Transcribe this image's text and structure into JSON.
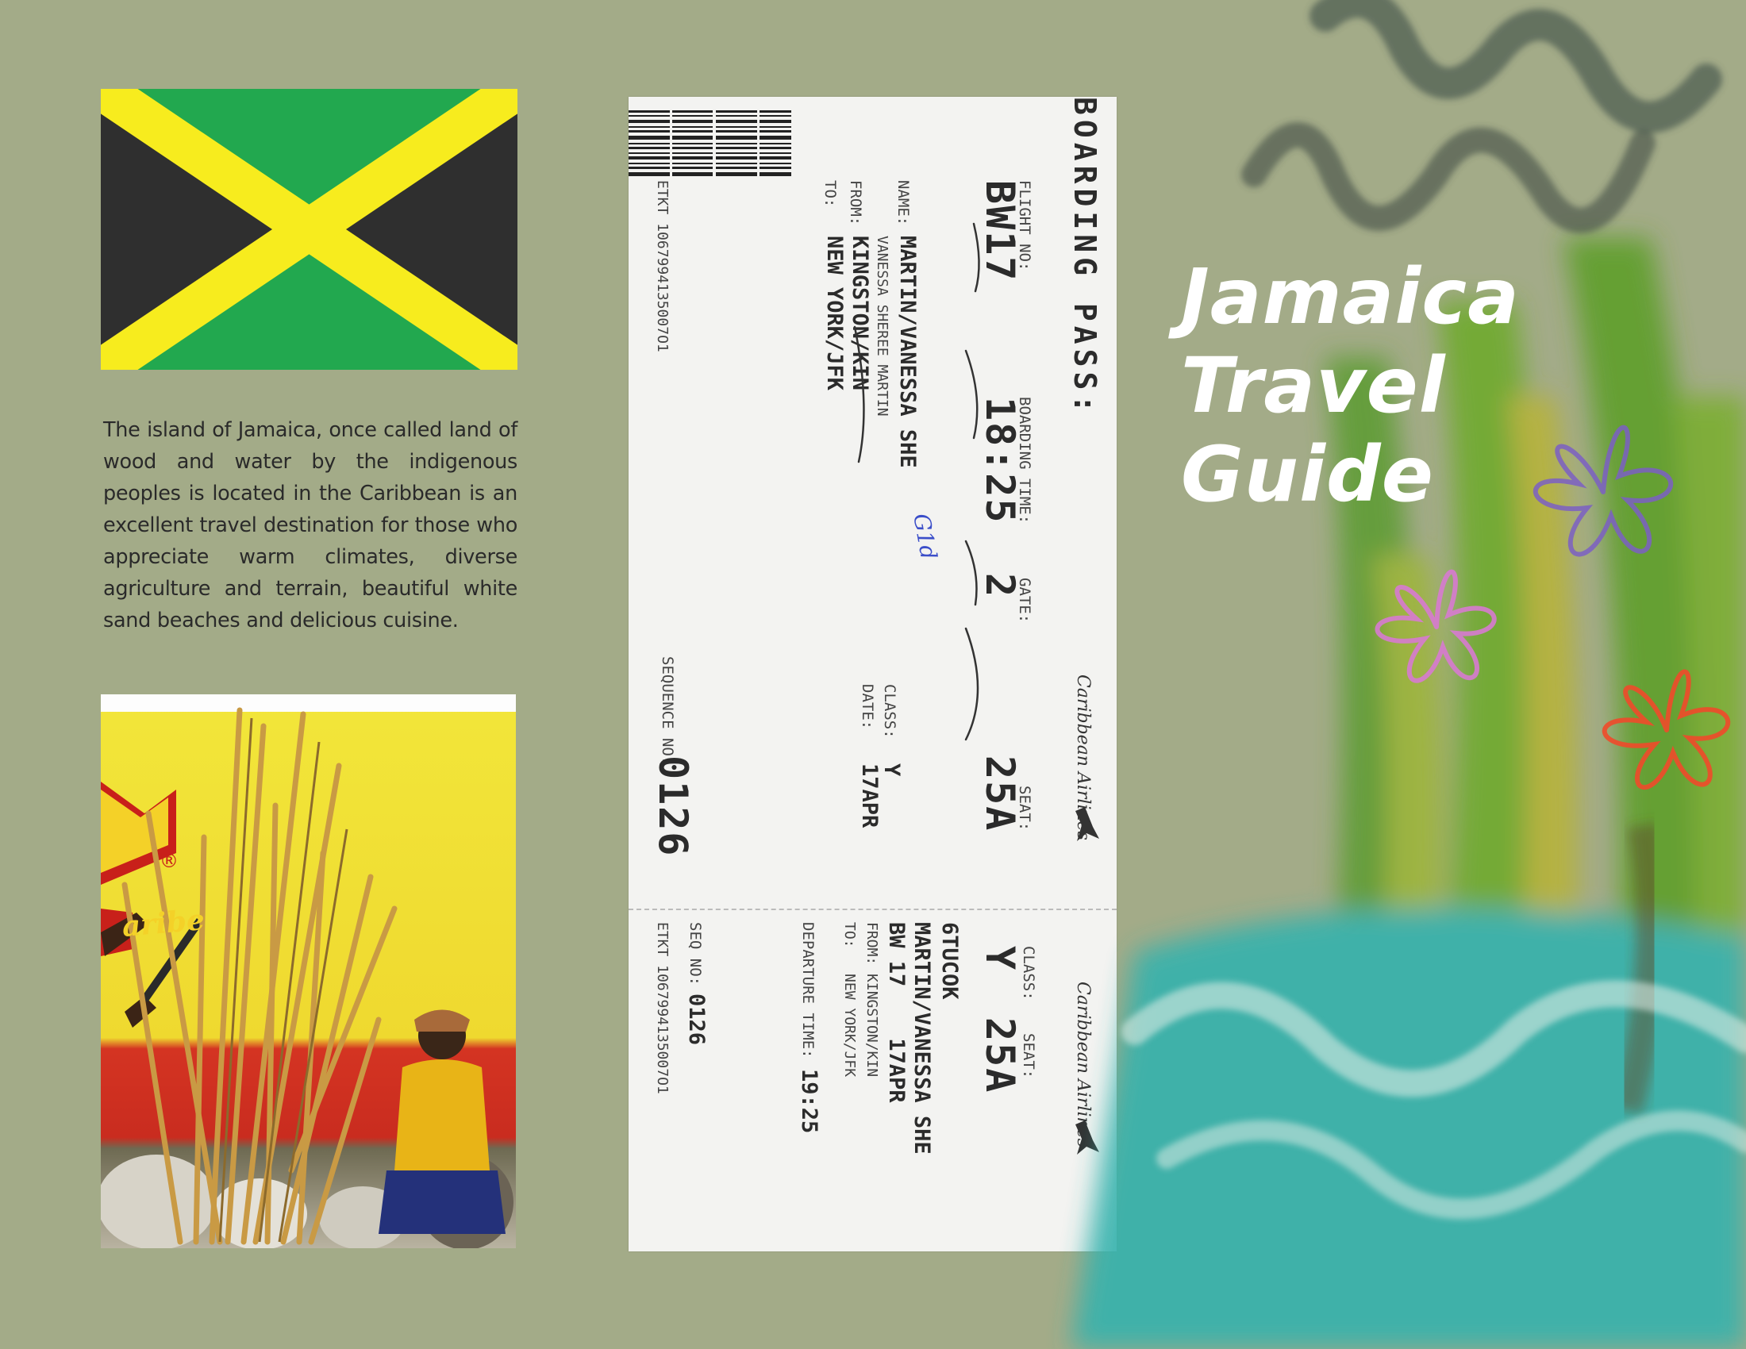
{
  "colors": {
    "background": "#a3ab88",
    "flag_black": "#2f2f2f",
    "flag_green": "#22a84f",
    "flag_yellow": "#f7ec1e",
    "title_text": "#ffffff"
  },
  "intro": {
    "text": "The island of Jamaica, once called land of wood and water by the indigenous peoples is located in the Caribbean is an excellent travel destination for those who appreciate warm climates, diverse agriculture and terrain, beautiful white sand beaches and delicious cuisine."
  },
  "title": {
    "line1": "Jamaica",
    "line2": "Travel",
    "line3": "Guide"
  },
  "photo": {
    "sign_mark": "®",
    "sign_text": "aribe"
  },
  "boarding_pass": {
    "header": "BOARDING PASS:",
    "airline": "Caribbean Airlines",
    "flight_label": "FLIGHT NO:",
    "flight": "BW17",
    "boarding_time_label": "BOARDING TIME:",
    "boarding_time": "18:25",
    "gate_label": "GATE:",
    "gate": "2",
    "seat_label": "SEAT:",
    "seat": "25A",
    "name_label": "NAME:",
    "name": "MARTIN/VANESSA SHE",
    "full_name": "VANESSA SHEREE MARTIN",
    "from_label": "FROM:",
    "from": "KINGSTON/KIN",
    "to_label": "TO:",
    "to": "NEW YORK/JFK",
    "class_label": "CLASS:",
    "class": "Y",
    "date_label": "DATE:",
    "date": "17APR",
    "etkt": "ETKT 1067994135007O1",
    "sequence_label": "SEQUENCE NO:",
    "sequence": "0126",
    "handwritten": "G1d",
    "stub": {
      "airline": "Caribbean Airlines",
      "class_label": "CLASS:",
      "seat_label": "SEAT:",
      "class": "Y",
      "seat": "25A",
      "code": "6TUCOK",
      "name": "MARTIN/VANESSA SHE",
      "flight_date": "BW 17    17APR",
      "from": "FROM: KINGSTON/KIN",
      "to": "TO:   NEW YORK/JFK",
      "departure_label": "DEPARTURE TIME:",
      "departure": "19:25",
      "seq_label": "SEQ NO:",
      "seq": "0126",
      "etkt": "ETKT 1067994135007O1"
    }
  }
}
